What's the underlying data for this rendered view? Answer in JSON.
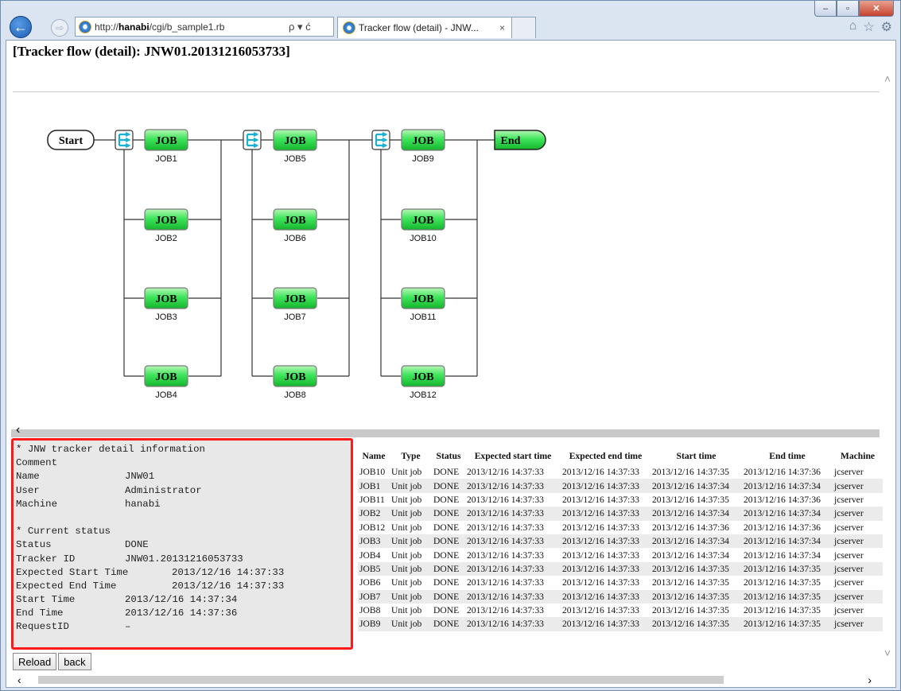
{
  "browser": {
    "url_prefix": "http://",
    "url_host": "hanabi",
    "url_path": "/cgi/b_sample1.rb",
    "address_controls": "ρ ▾ ć",
    "tab_title": "Tracker flow (detail) - JNW...",
    "tab_close": "×",
    "back_glyph": "←",
    "forward_glyph": "⇨",
    "icons": [
      "home-icon",
      "favorites-star-icon",
      "tools-gear-icon"
    ],
    "caption": {
      "minimize": "–",
      "maximize": "▫",
      "close": "✕"
    }
  },
  "page": {
    "title": "[Tracker flow (detail): JNW01.20131216053733]"
  },
  "flow": {
    "start_label": "Start",
    "end_label": "End",
    "job_badge": "JOB",
    "branch_icon": "parallel-branch-icon",
    "columns": [
      [
        "JOB1",
        "JOB2",
        "JOB3",
        "JOB4"
      ],
      [
        "JOB5",
        "JOB6",
        "JOB7",
        "JOB8"
      ],
      [
        "JOB9",
        "JOB10",
        "JOB11",
        "JOB12"
      ]
    ],
    "colors": {
      "job_fill": "#2fd14a",
      "job_border": "#0a8a1c",
      "branch": "#1ab0d8",
      "line": "#333333"
    }
  },
  "info": {
    "rows": [
      {
        "k": "* JNW tracker detail information",
        "v": ""
      },
      {
        "k": "Comment",
        "v": ""
      },
      {
        "k": "Name",
        "v": "JNW01"
      },
      {
        "k": "User",
        "v": "Administrator"
      },
      {
        "k": "Machine",
        "v": "hanabi"
      },
      {
        "k": "",
        "v": ""
      },
      {
        "k": "* Current status",
        "v": ""
      },
      {
        "k": "Status",
        "v": "DONE"
      },
      {
        "k": "Tracker ID",
        "v": "JNW01.20131216053733"
      },
      {
        "k": "Expected Start Time",
        "v": "2013/12/16 14:37:33"
      },
      {
        "k": "Expected End Time",
        "v": "2013/12/16 14:37:33"
      },
      {
        "k": "Start Time",
        "v": "2013/12/16 14:37:34"
      },
      {
        "k": "End Time",
        "v": "2013/12/16 14:37:36"
      },
      {
        "k": "RequestID",
        "v": "–"
      }
    ]
  },
  "jobs": {
    "headers": [
      "Name",
      "Type",
      "Status",
      "Expected start time",
      "Expected end time",
      "Start time",
      "End time",
      "Machine"
    ],
    "rows": [
      [
        "JOB10",
        "Unit job",
        "DONE",
        "2013/12/16 14:37:33",
        "2013/12/16 14:37:33",
        "2013/12/16 14:37:35",
        "2013/12/16 14:37:36",
        "jcserver"
      ],
      [
        "JOB1",
        "Unit job",
        "DONE",
        "2013/12/16 14:37:33",
        "2013/12/16 14:37:33",
        "2013/12/16 14:37:34",
        "2013/12/16 14:37:34",
        "jcserver"
      ],
      [
        "JOB11",
        "Unit job",
        "DONE",
        "2013/12/16 14:37:33",
        "2013/12/16 14:37:33",
        "2013/12/16 14:37:35",
        "2013/12/16 14:37:36",
        "jcserver"
      ],
      [
        "JOB2",
        "Unit job",
        "DONE",
        "2013/12/16 14:37:33",
        "2013/12/16 14:37:33",
        "2013/12/16 14:37:34",
        "2013/12/16 14:37:34",
        "jcserver"
      ],
      [
        "JOB12",
        "Unit job",
        "DONE",
        "2013/12/16 14:37:33",
        "2013/12/16 14:37:33",
        "2013/12/16 14:37:36",
        "2013/12/16 14:37:36",
        "jcserver"
      ],
      [
        "JOB3",
        "Unit job",
        "DONE",
        "2013/12/16 14:37:33",
        "2013/12/16 14:37:33",
        "2013/12/16 14:37:34",
        "2013/12/16 14:37:34",
        "jcserver"
      ],
      [
        "JOB4",
        "Unit job",
        "DONE",
        "2013/12/16 14:37:33",
        "2013/12/16 14:37:33",
        "2013/12/16 14:37:34",
        "2013/12/16 14:37:34",
        "jcserver"
      ],
      [
        "JOB5",
        "Unit job",
        "DONE",
        "2013/12/16 14:37:33",
        "2013/12/16 14:37:33",
        "2013/12/16 14:37:35",
        "2013/12/16 14:37:35",
        "jcserver"
      ],
      [
        "JOB6",
        "Unit job",
        "DONE",
        "2013/12/16 14:37:33",
        "2013/12/16 14:37:33",
        "2013/12/16 14:37:35",
        "2013/12/16 14:37:35",
        "jcserver"
      ],
      [
        "JOB7",
        "Unit job",
        "DONE",
        "2013/12/16 14:37:33",
        "2013/12/16 14:37:33",
        "2013/12/16 14:37:35",
        "2013/12/16 14:37:35",
        "jcserver"
      ],
      [
        "JOB8",
        "Unit job",
        "DONE",
        "2013/12/16 14:37:33",
        "2013/12/16 14:37:33",
        "2013/12/16 14:37:35",
        "2013/12/16 14:37:35",
        "jcserver"
      ],
      [
        "JOB9",
        "Unit job",
        "DONE",
        "2013/12/16 14:37:33",
        "2013/12/16 14:37:33",
        "2013/12/16 14:37:35",
        "2013/12/16 14:37:35",
        "jcserver"
      ]
    ]
  },
  "buttons": {
    "reload": "Reload",
    "back": "back"
  },
  "scroll": {
    "left": "‹",
    "right": "›",
    "up": "˄",
    "down": "˅"
  }
}
